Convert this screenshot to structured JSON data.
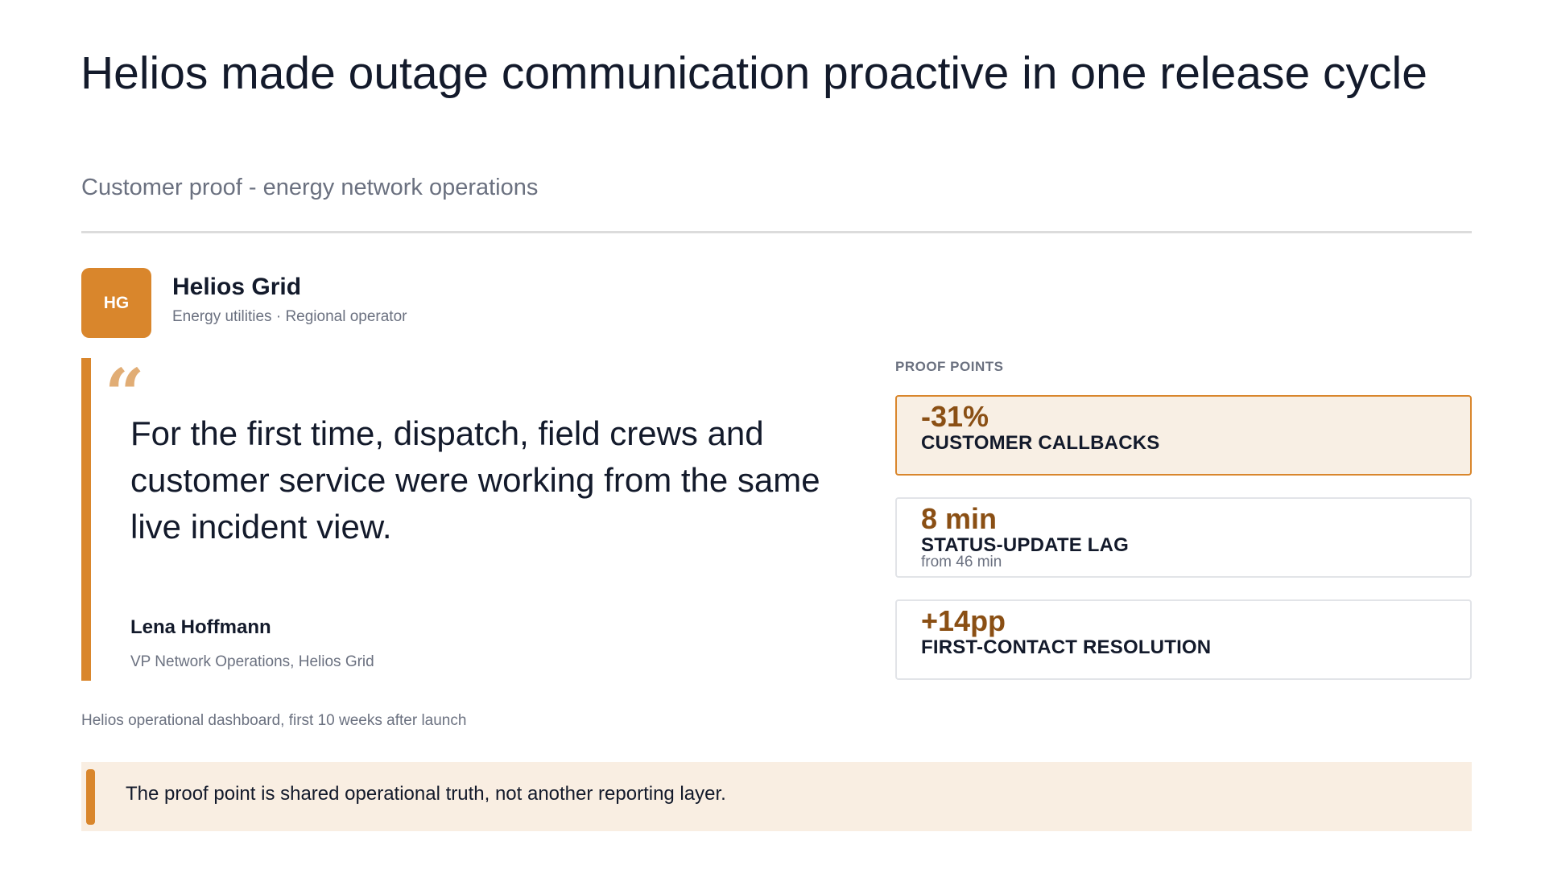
{
  "header": {
    "title": "Helios made outage communication proactive in one release cycle",
    "subtitle": "Customer proof - energy network operations"
  },
  "company": {
    "logo_initials": "HG",
    "logo_color": "#d9862c",
    "name": "Helios Grid",
    "meta": "Energy utilities · Regional operator"
  },
  "quote": {
    "mark": "“",
    "text": "For the first time, dispatch, field crews and customer service were working from the same live incident view.",
    "author_name": "Lena Hoffmann",
    "author_role": "VP Network Operations, Helios Grid"
  },
  "source_note": "Helios operational dashboard, first 10 weeks after launch",
  "proof_points": {
    "heading": "PROOF POINTS",
    "items": [
      {
        "value": "-31%",
        "label": "CUSTOMER CALLBACKS",
        "sub": ""
      },
      {
        "value": "8 min",
        "label": "STATUS-UPDATE LAG",
        "sub": "from 46 min"
      },
      {
        "value": "+14pp",
        "label": "FIRST-CONTACT RESOLUTION",
        "sub": ""
      }
    ]
  },
  "callout": {
    "text": "The proof point is shared operational truth, not another reporting layer."
  },
  "colors": {
    "accent": "#d9862c",
    "accent_dark": "#8a4f14",
    "highlight_bg": "#f8efe4",
    "text": "#131a2b",
    "muted": "#6b7180"
  }
}
